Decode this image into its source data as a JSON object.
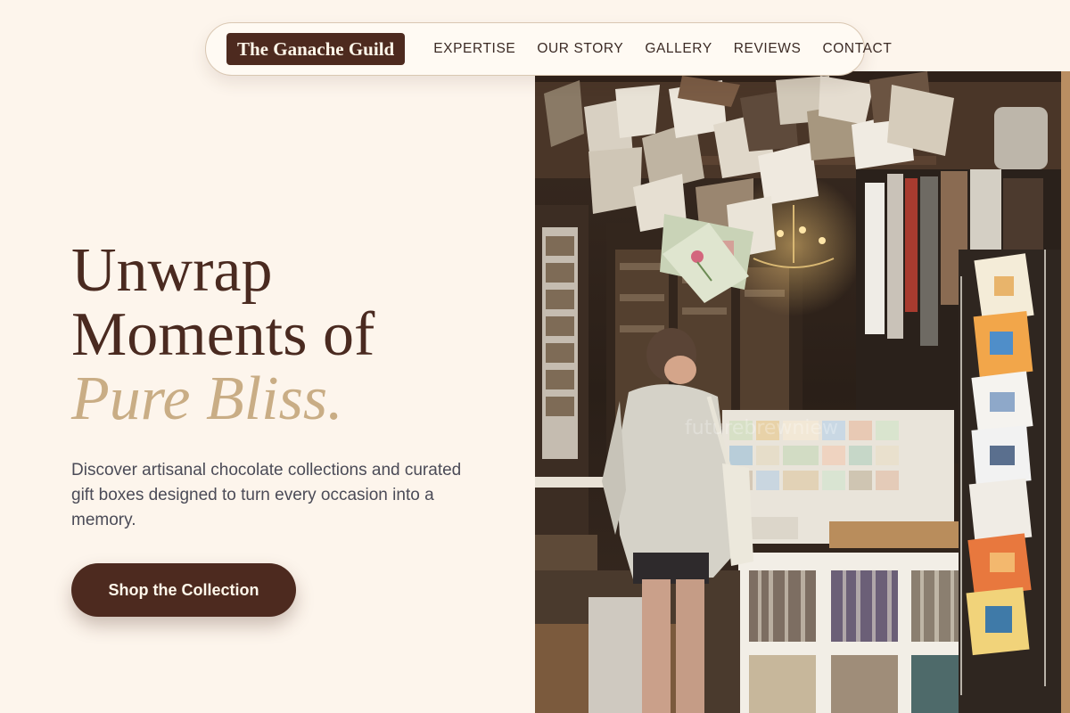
{
  "brand": {
    "name": "The Ganache Guild"
  },
  "nav": {
    "items": [
      {
        "label": "EXPERTISE"
      },
      {
        "label": "OUR STORY"
      },
      {
        "label": "GALLERY"
      },
      {
        "label": "REVIEWS"
      },
      {
        "label": "CONTACT"
      }
    ]
  },
  "hero": {
    "headline_line1": "Unwrap",
    "headline_line2": "Moments of",
    "headline_accent": "Pure Bliss.",
    "subtext": "Discover artisanal chocolate collections and curated gift boxes designed to turn every occasion into a memory.",
    "cta_label": "Shop the Collection"
  },
  "image": {
    "watermark": "futurebrewniew"
  },
  "colors": {
    "background": "#fdf5ec",
    "brand_dark": "#4d2a1f",
    "accent_gold": "#c9ad85",
    "body_text": "#4b4b57"
  }
}
